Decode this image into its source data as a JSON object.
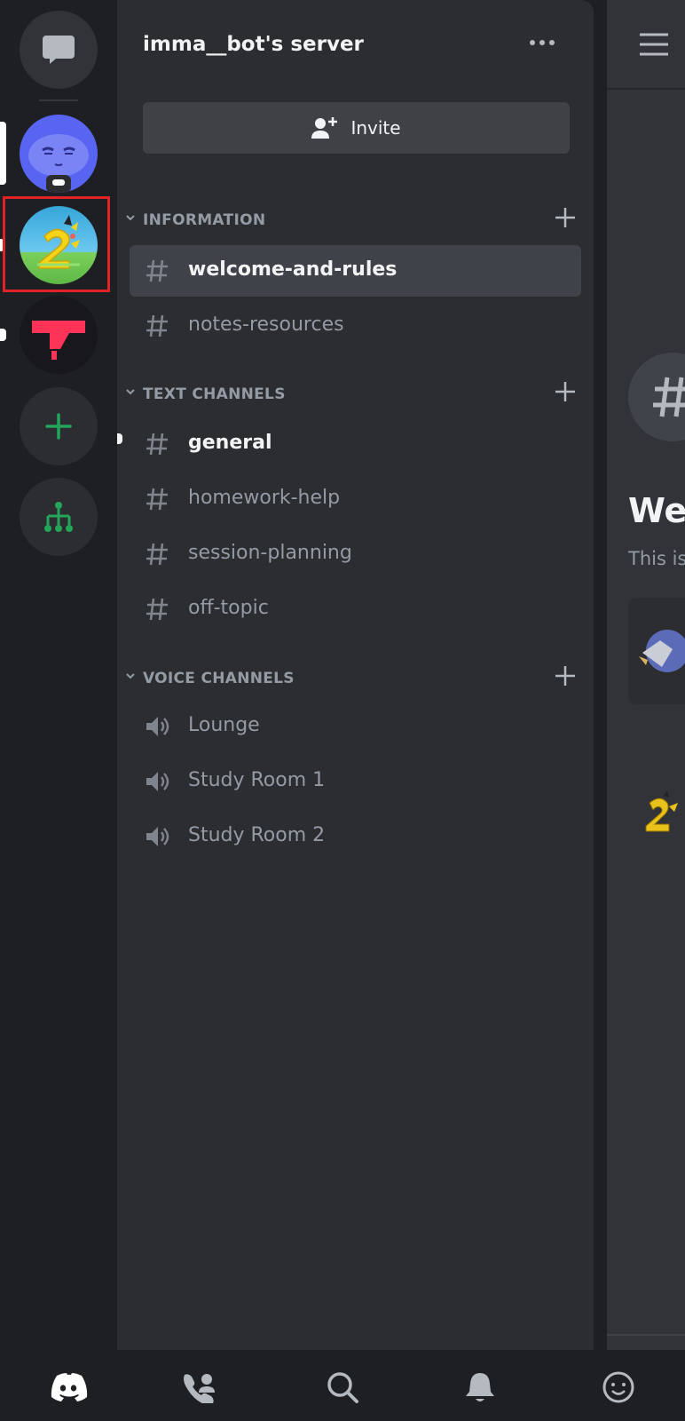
{
  "server": {
    "name": "imma__bot's server",
    "invite_label": "Invite"
  },
  "rail": {
    "servers": [
      {
        "icon": "direct-messages-icon"
      },
      {
        "icon": "discord-bot-avatar"
      },
      {
        "icon": "pikachu-2-server-icon",
        "highlighted": true
      },
      {
        "icon": "red-t-server-icon"
      },
      {
        "icon": "add-server-icon"
      },
      {
        "icon": "explore-servers-icon"
      }
    ],
    "colors": {
      "highlight_border": "#e12227",
      "add_green": "#23a55a"
    }
  },
  "categories": [
    {
      "label": "INFORMATION",
      "channels": [
        {
          "name": "welcome-and-rules",
          "type": "text",
          "state": "selected"
        },
        {
          "name": "notes-resources",
          "type": "text",
          "state": "normal"
        }
      ]
    },
    {
      "label": "TEXT CHANNELS",
      "channels": [
        {
          "name": "general",
          "type": "text",
          "state": "unread"
        },
        {
          "name": "homework-help",
          "type": "text",
          "state": "normal"
        },
        {
          "name": "session-planning",
          "type": "text",
          "state": "normal"
        },
        {
          "name": "off-topic",
          "type": "text",
          "state": "normal"
        }
      ]
    },
    {
      "label": "VOICE CHANNELS",
      "channels": [
        {
          "name": "Lounge",
          "type": "voice",
          "state": "normal"
        },
        {
          "name": "Study Room 1",
          "type": "voice",
          "state": "normal"
        },
        {
          "name": "Study Room 2",
          "type": "voice",
          "state": "normal"
        }
      ]
    }
  ],
  "peek": {
    "welcome_fragment": "Wel",
    "subtitle_fragment": "This is"
  },
  "bottom_nav": [
    {
      "icon": "discord-home-icon",
      "active": true
    },
    {
      "icon": "friends-icon",
      "active": false
    },
    {
      "icon": "search-icon",
      "active": false
    },
    {
      "icon": "notifications-bell-icon",
      "active": false
    },
    {
      "icon": "profile-smiley-icon",
      "active": false
    }
  ]
}
